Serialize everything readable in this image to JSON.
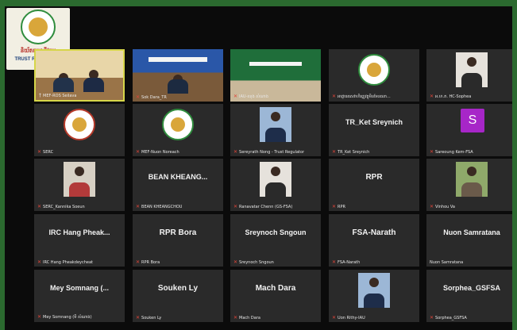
{
  "logo": {
    "khmer_text": "និយ័តករអាជីវកម្ម",
    "english_text": "TRUST REGULATOR"
  },
  "tiles": [
    {
      "name": "",
      "label": "MEF-ROS Seilava",
      "icon": "pin-icon",
      "kind": "video-meeting-room"
    },
    {
      "name": "",
      "label": "Sok Dara_TR",
      "icon": "mic-muted-icon",
      "kind": "video-conference-hall"
    },
    {
      "name": "",
      "label": "IAU-ឈុង សំណាង",
      "icon": "mic-muted-icon",
      "kind": "video-stage"
    },
    {
      "name": "",
      "label": "អាជ្ញាធរសេវាហិរញ្ញវត្ថុមិនមែនធនា...",
      "icon": "mic-muted-icon",
      "kind": "logo-seal"
    },
    {
      "name": "",
      "label": "អ.ហ.ភ. HC-Sophea",
      "icon": "mic-muted-icon",
      "kind": "photo-woman"
    },
    {
      "name": "",
      "label": "SERC",
      "icon": "mic-muted-icon",
      "kind": "logo-serc"
    },
    {
      "name": "",
      "label": "MEF-Nuon Noreach",
      "icon": "mic-muted-icon",
      "kind": "logo-seal"
    },
    {
      "name": "",
      "label": "Sereyrath Nong - Trust Regulator",
      "icon": "mic-muted-icon",
      "kind": "photo-man"
    },
    {
      "name": "TR_Ket Sreynich",
      "label": "TR_Ket Sreynich",
      "icon": "mic-muted-icon",
      "kind": "name"
    },
    {
      "name": "S",
      "label": "Sareoung Kem-FSA",
      "icon": "mic-muted-icon",
      "kind": "initial"
    },
    {
      "name": "",
      "label": "SERC_Kannika Soeun",
      "icon": "mic-muted-icon",
      "kind": "photo-woman-desk"
    },
    {
      "name": "BEAN KHEANG...",
      "label": "BEAN KHEANGCHOU",
      "icon": "mic-muted-icon",
      "kind": "name"
    },
    {
      "name": "",
      "label": "Ranavatar Chenn (GS-FSA)",
      "icon": "mic-muted-icon",
      "kind": "photo-woman"
    },
    {
      "name": "RPR",
      "label": "RPR",
      "icon": "mic-muted-icon",
      "kind": "name"
    },
    {
      "name": "",
      "label": "Vinhou Va",
      "icon": "mic-muted-icon",
      "kind": "photo-outdoor"
    },
    {
      "name": "IRC Hang Pheak...",
      "label": "IRC Hang Pheakdeycheat",
      "icon": "mic-muted-icon",
      "kind": "name"
    },
    {
      "name": "RPR Bora",
      "label": "RPR Bora",
      "icon": "mic-muted-icon",
      "kind": "name"
    },
    {
      "name": "Sreynoch Sngoun",
      "label": "Sreynoch Sngoun",
      "icon": "mic-muted-icon",
      "kind": "name"
    },
    {
      "name": "FSA-Narath",
      "label": "FSA-Narath",
      "icon": "mic-muted-icon",
      "kind": "name"
    },
    {
      "name": "Nuon Samratana",
      "label": "Nuon Samratana",
      "icon": "",
      "kind": "name"
    },
    {
      "name": "Mey Somnang (...",
      "label": "Mey Somnang (មី សំណាង)",
      "icon": "mic-muted-icon",
      "kind": "name"
    },
    {
      "name": "Souken Ly",
      "label": "Souken Ly",
      "icon": "mic-muted-icon",
      "kind": "name"
    },
    {
      "name": "Mach Dara",
      "label": "Mach Dara",
      "icon": "mic-muted-icon",
      "kind": "name"
    },
    {
      "name": "",
      "label": "Uon Rithy-IAU",
      "icon": "mic-muted-icon",
      "kind": "photo-man"
    },
    {
      "name": "Sorphea_GSFSA",
      "label": "Sorphea_GSFSA",
      "icon": "mic-muted-icon",
      "kind": "name"
    }
  ],
  "colors": {
    "frame": "#2b6a2f",
    "tile": "#2a2a2a",
    "active_border": "#d6d64a",
    "muted_mic": "#e0453a",
    "initial_avatar": "#a726c8"
  }
}
